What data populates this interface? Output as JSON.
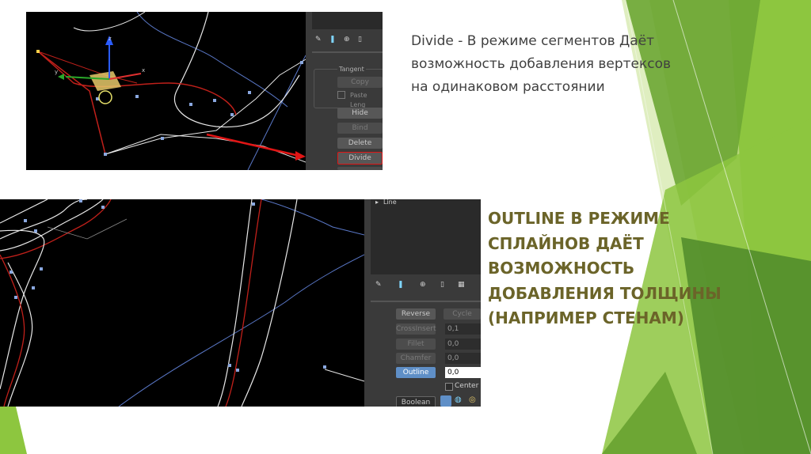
{
  "slide": {
    "text1": "Divide - В режиме сегментов Даёт возможность добавления вертексов на одинаковом расстоянии",
    "text2": "Outline в режиме сплайнов даёт возможность добавления толщины (например стенам)"
  },
  "panel1": {
    "group_title": "Tangent",
    "copy_label": "Copy",
    "paste_length_label": "Paste Leng",
    "hide_label": "Hide",
    "bind_label": "Bind",
    "delete_label": "Delete",
    "divide_label": "Divide"
  },
  "panel2": {
    "object_name": "Line",
    "reverse_label": "Reverse",
    "cycle_label": "Cycle",
    "crossinsert_label": "CrossInsert",
    "crossinsert_value": "0,1",
    "fillet_label": "Fillet",
    "fillet_value": "0,0",
    "chamfer_label": "Chamfer",
    "chamfer_value": "0,0",
    "outline_label": "Outline",
    "outline_value": "0,0",
    "center_label": "Center",
    "boolean_label": "Boolean"
  },
  "viewport1": {
    "gizmo_axes": [
      "z",
      "y",
      "x"
    ]
  },
  "colors": {
    "accent_green": "#8dc63f",
    "dark_green": "#4f8a2a",
    "olive_text": "#6b6429",
    "spline_red": "#c0201a",
    "selection_blue": "#5f8fc7"
  }
}
